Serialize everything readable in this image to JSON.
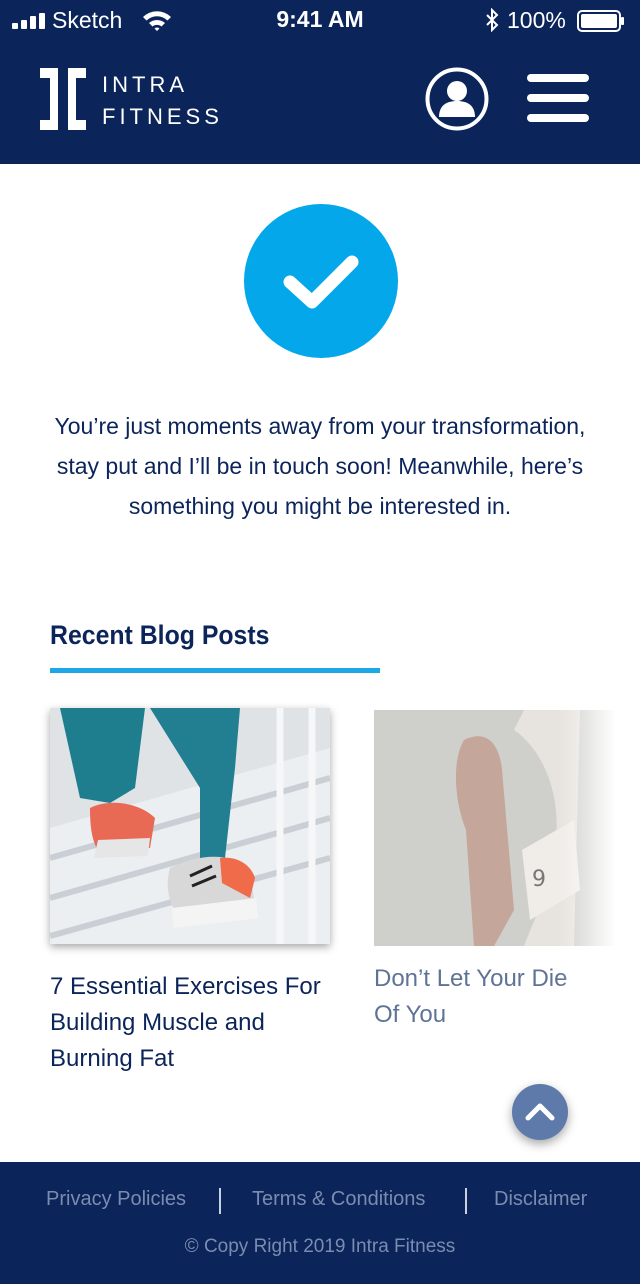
{
  "status_bar": {
    "carrier": "Sketch",
    "time": "9:41 AM",
    "battery_percent": "100%"
  },
  "header": {
    "brand_line1": "INTRA",
    "brand_line2": "FITNESS"
  },
  "confirmation": {
    "message": "You’re just moments away from your transformation, stay put and I’ll be in touch soon! Meanwhile, here’s something you might be interested in."
  },
  "blog": {
    "section_title": "Recent Blog Posts",
    "posts": [
      {
        "title": "7 Essential Exercises For Building Muscle and Burning Fat"
      },
      {
        "title": "Don’t Let Your Die\nOf You"
      }
    ]
  },
  "footer": {
    "links": [
      "Privacy Policies",
      "Terms & Conditions",
      "Disclaimer"
    ],
    "copyright": "© Copy Right 2019 Intra Fitness"
  },
  "colors": {
    "navy": "#0b2459",
    "accent_blue": "#03a7ea",
    "rule_blue": "#1ca8e6",
    "scroll_button": "#5d7aaa",
    "footer_text": "#7a8cb0"
  },
  "icons": {
    "status": [
      "signal-icon",
      "wifi-icon",
      "bluetooth-icon",
      "battery-icon"
    ],
    "header": [
      "intra-logo-icon",
      "profile-icon",
      "hamburger-menu-icon"
    ],
    "content": [
      "checkmark-icon",
      "chevron-up-icon"
    ]
  }
}
